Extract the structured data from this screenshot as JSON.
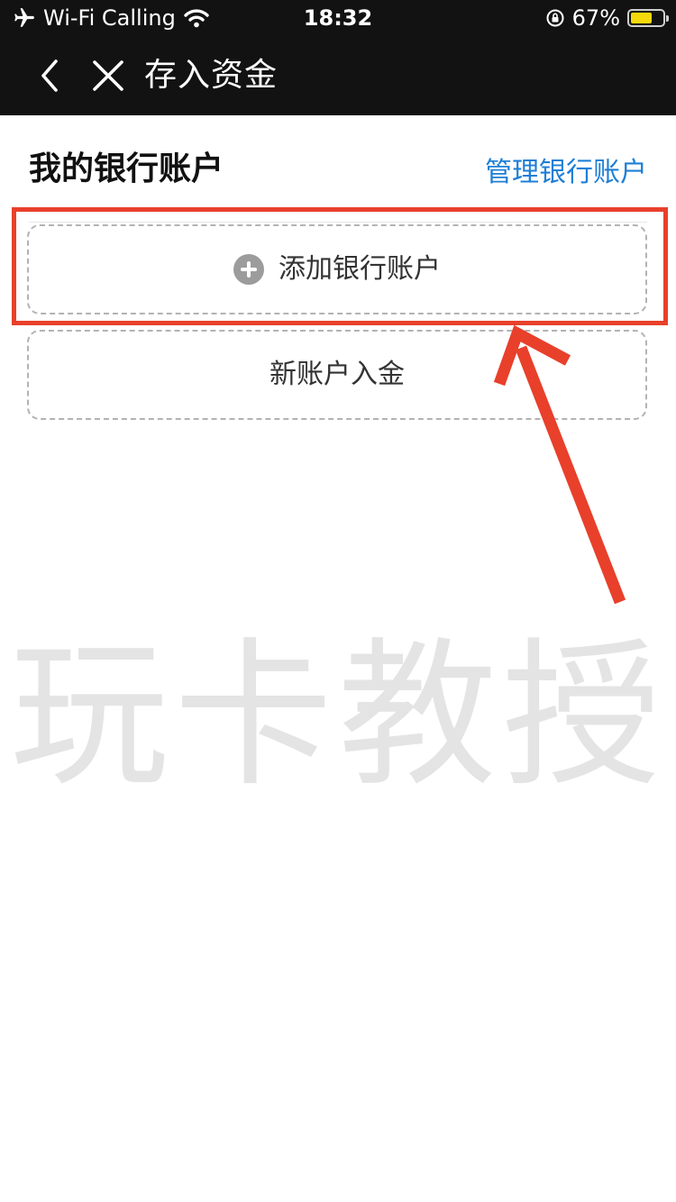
{
  "status_bar": {
    "carrier": "Wi-Fi Calling",
    "time": "18:32",
    "battery_percent": "67%",
    "battery_level": 0.67,
    "icons": [
      "airplane-icon",
      "wifi-icon",
      "rotation-lock-icon",
      "battery-icon"
    ]
  },
  "nav": {
    "title": "存入资金",
    "back_icon": "chevron-left-icon",
    "close_icon": "close-icon"
  },
  "section": {
    "title": "我的银行账户",
    "manage_link": "管理银行账户"
  },
  "cards": {
    "add_bank_account": "添加银行账户",
    "new_account_deposit": "新账户入金"
  },
  "watermark": "玩卡教授",
  "colors": {
    "header_bg": "#121212",
    "link_blue": "#1e7fd6",
    "annotation_red": "#e8402b",
    "battery_yellow": "#f5d90a"
  }
}
